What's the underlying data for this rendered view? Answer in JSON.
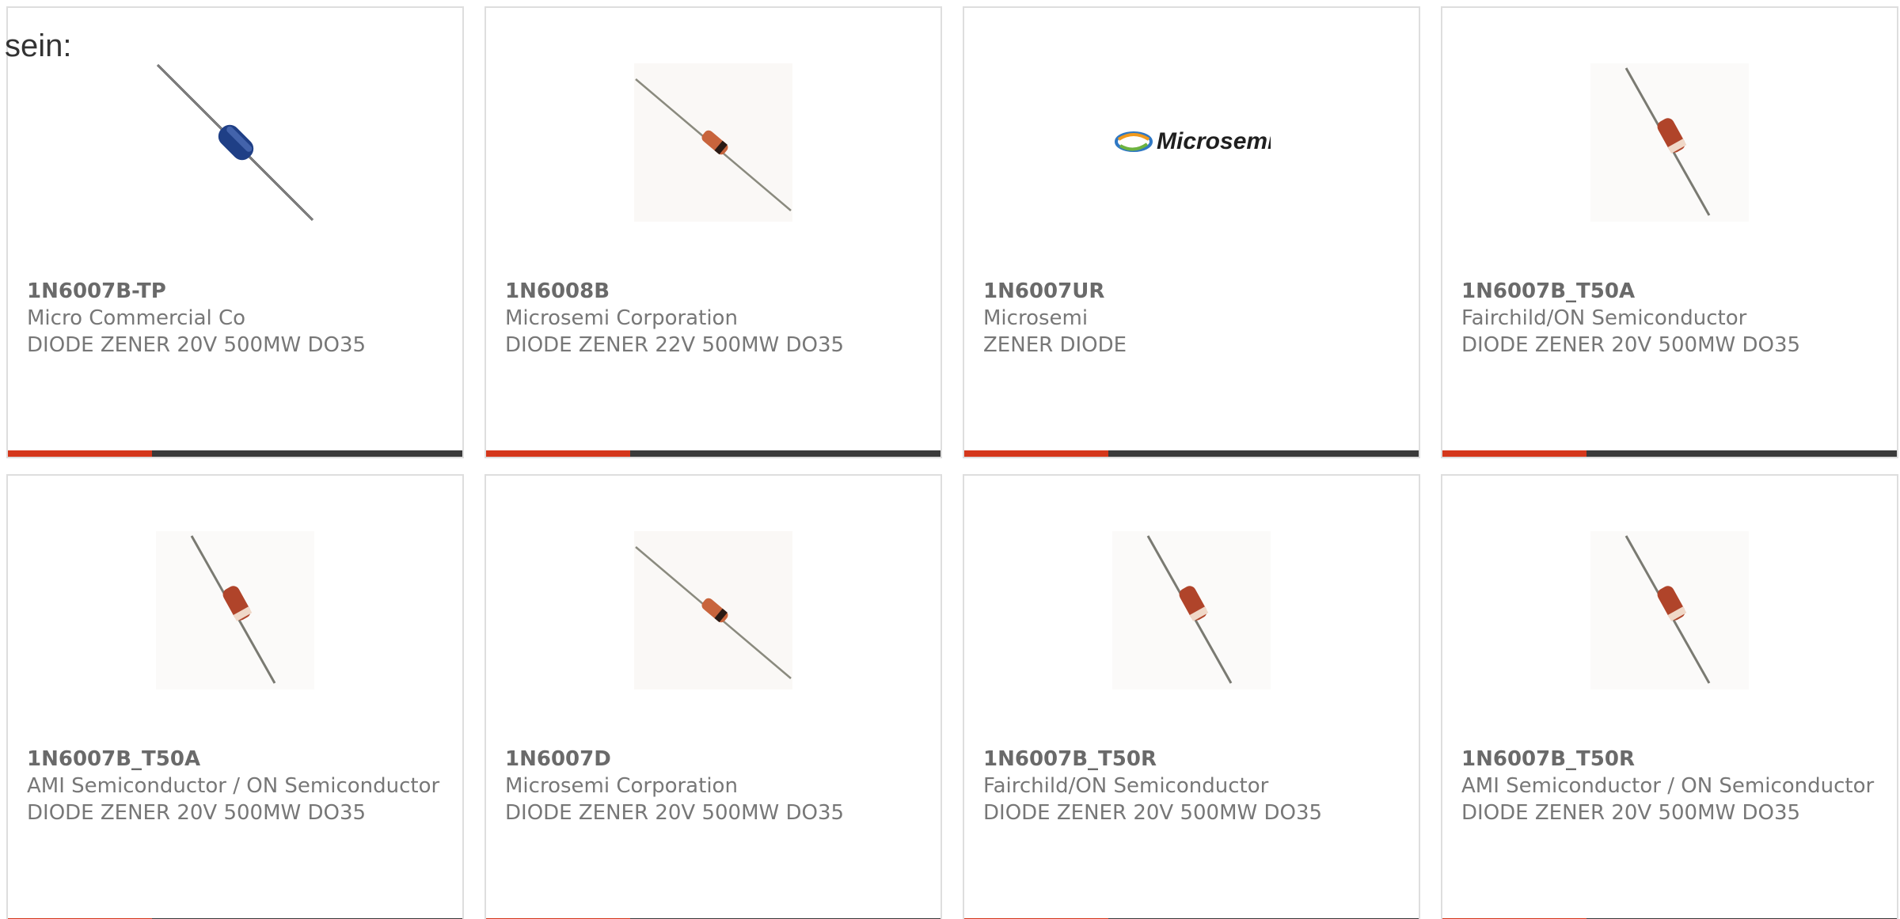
{
  "lead_text": "sein:",
  "colors": {
    "accent": "#d4371b",
    "bar_dark": "#3a3a3a",
    "card_border": "#dedede",
    "text_muted": "#777777"
  },
  "products": [
    {
      "part_number": "1N6007B-TP",
      "manufacturer": "Micro Commercial Co",
      "description": "DIODE ZENER 20V 500MW DO35",
      "image_icon": "blue-axial-diode-icon"
    },
    {
      "part_number": "1N6008B",
      "manufacturer": "Microsemi Corporation",
      "description": "DIODE ZENER 22V 500MW DO35",
      "image_icon": "glass-axial-diode-icon"
    },
    {
      "part_number": "1N6007UR",
      "manufacturer": "Microsemi",
      "description": "ZENER DIODE",
      "image_icon": "microsemi-logo",
      "logo_text": "Microsemi"
    },
    {
      "part_number": "1N6007B_T50A",
      "manufacturer": "Fairchild/ON Semiconductor",
      "description": "DIODE ZENER 20V 500MW DO35",
      "image_icon": "glass-axial-diode-icon"
    },
    {
      "part_number": "1N6007B_T50A",
      "manufacturer": "AMI Semiconductor / ON Semiconductor",
      "description": "DIODE ZENER 20V 500MW DO35",
      "image_icon": "glass-axial-diode-icon"
    },
    {
      "part_number": "1N6007D",
      "manufacturer": "Microsemi Corporation",
      "description": "DIODE ZENER 20V 500MW DO35",
      "image_icon": "glass-axial-diode-icon"
    },
    {
      "part_number": "1N6007B_T50R",
      "manufacturer": "Fairchild/ON Semiconductor",
      "description": "DIODE ZENER 20V 500MW DO35",
      "image_icon": "glass-axial-diode-icon"
    },
    {
      "part_number": "1N6007B_T50R",
      "manufacturer": "AMI Semiconductor / ON Semiconductor",
      "description": "DIODE ZENER 20V 500MW DO35",
      "image_icon": "glass-axial-diode-icon"
    }
  ]
}
